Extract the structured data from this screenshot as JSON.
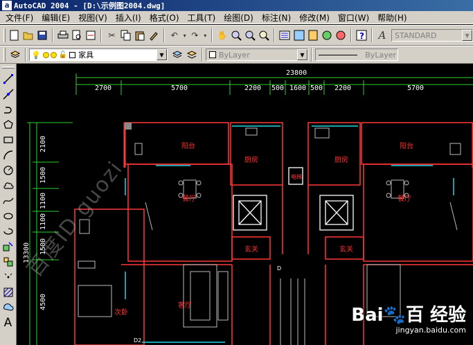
{
  "window": {
    "app_icon": "a",
    "title": "AutoCAD 2004 - [D:\\示例图2004.dwg]"
  },
  "menu": [
    "文件(F)",
    "编辑(E)",
    "视图(V)",
    "插入(I)",
    "格式(O)",
    "工具(T)",
    "绘图(D)",
    "标注(N)",
    "修改(M)",
    "窗口(W)",
    "帮助(H)"
  ],
  "toolbar": {
    "text_style": "STANDARD",
    "layer": "家具",
    "color": "ByLayer",
    "linetype": "ByLayer"
  },
  "left_tools": [
    "line-icon",
    "polyline-icon",
    "arc-icon",
    "polygon-icon",
    "rectangle-icon",
    "curve-icon",
    "circle-icon",
    "cloud-icon",
    "spline-icon",
    "ellipse-icon",
    "ellipse-arc-icon",
    "block-icon",
    "insert-icon",
    "point-icon",
    "hatch-icon",
    "region-icon",
    "text-icon"
  ],
  "drawing": {
    "total_width": "23800",
    "top_dims": [
      "2700",
      "5700",
      "2200",
      "500",
      "1600",
      "500",
      "2200",
      "5700"
    ],
    "left_dims": [
      "2100",
      "1500",
      "1100",
      "1100",
      "1500",
      "4500"
    ],
    "total_height": "13300",
    "rooms": {
      "balcony_left": "阳台",
      "balcony_right": "阳台",
      "kitchen_left": "厨房",
      "kitchen_right": "厨房",
      "dining_left": "餐厅",
      "dining_right": "餐厅",
      "entry_left": "玄关",
      "entry_right": "玄关",
      "living_left": "客厅",
      "bedroom_left": "次卧",
      "elevator_label": "电梯",
      "door_label_1": "D",
      "door_label_2": "D2"
    },
    "watermark": "百度ID guozi",
    "baidu_logo": "Bai🐾百 经验",
    "baidu_url": "jingyan.baidu.com"
  }
}
